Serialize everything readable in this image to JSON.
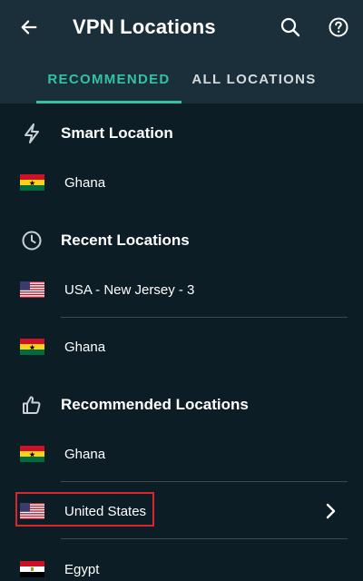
{
  "appbar": {
    "title": "VPN Locations",
    "back_icon": "arrow-left-icon",
    "search_icon": "search-icon",
    "help_icon": "help-circle-icon"
  },
  "tabs": [
    {
      "label": "RECOMMENDED",
      "active": true
    },
    {
      "label": "ALL LOCATIONS",
      "active": false
    }
  ],
  "sections": {
    "smart": {
      "title": "Smart Location",
      "icon": "lightning-icon"
    },
    "recent": {
      "title": "Recent Locations",
      "icon": "clock-icon"
    },
    "recommended": {
      "title": "Recommended Locations",
      "icon": "thumbs-up-icon"
    }
  },
  "locations": {
    "smart": [
      {
        "label": "Ghana",
        "flag": "ghana-flag"
      }
    ],
    "recent": [
      {
        "label": "USA - New Jersey - 3",
        "flag": "usa-flag"
      },
      {
        "label": "Ghana",
        "flag": "ghana-flag"
      }
    ],
    "recommended": [
      {
        "label": "Ghana",
        "flag": "ghana-flag"
      },
      {
        "label": "United States",
        "flag": "usa-flag",
        "expandable": true,
        "highlighted": true
      },
      {
        "label": "Egypt",
        "flag": "egypt-flag"
      }
    ]
  },
  "colors": {
    "background": "#0d1d26",
    "header": "#1b2f3a",
    "accent": "#34c2a3",
    "divider": "#3b4b55",
    "highlight": "#d9262c"
  }
}
